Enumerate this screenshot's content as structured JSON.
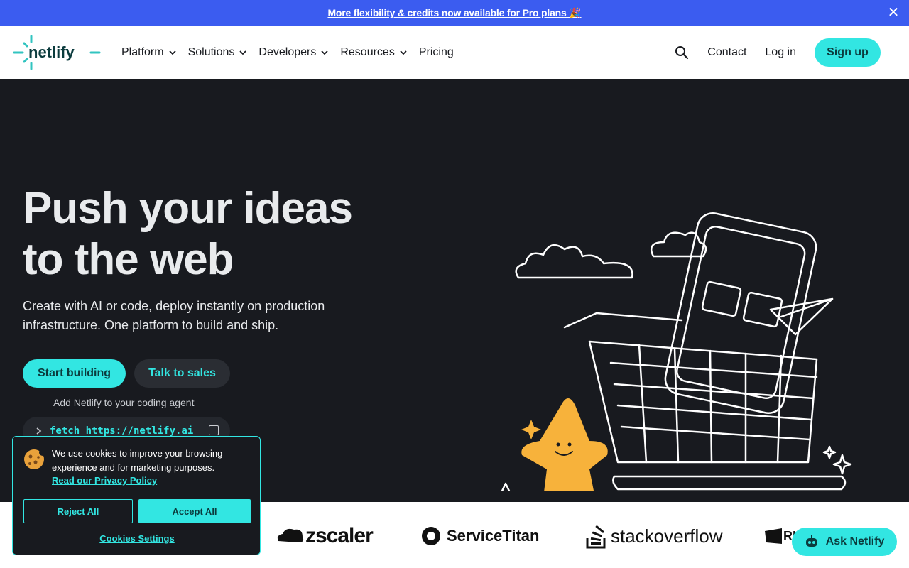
{
  "banner": {
    "text": "More flexibility & credits now available for Pro plans 🎉",
    "close": "✕"
  },
  "header": {
    "logo_text": "netlify",
    "nav": [
      {
        "label": "Platform"
      },
      {
        "label": "Solutions"
      },
      {
        "label": "Developers"
      },
      {
        "label": "Resources"
      },
      {
        "label": "Pricing"
      }
    ],
    "contact": "Contact",
    "login": "Log in",
    "signup": "Sign up",
    "search_icon": "search-icon"
  },
  "hero": {
    "title_line1": "Push your ideas",
    "title_line2": "to the web",
    "subtitle": "Create with AI or code, deploy instantly on production infrastructure. One platform to build and ship.",
    "primary_cta": "Start building",
    "secondary_cta": "Talk to sales",
    "agent_label": "Add Netlify to your coding agent",
    "agent_command": "fetch https://netlify.ai"
  },
  "logos": {
    "items": [
      "zscaler",
      "ServiceTitan",
      "stackoverflow",
      "RIOT"
    ]
  },
  "cookie": {
    "text": "We use cookies to improve your browsing experience and for marketing purposes.",
    "link": "Read our Privacy Policy",
    "reject": "Reject All",
    "accept": "Accept All",
    "settings": "Cookies Settings"
  },
  "ask": {
    "label": "Ask Netlify"
  },
  "colors": {
    "accent": "#32e6e2",
    "banner": "#3b5cf0",
    "dark": "#181a1f",
    "star": "#f7b23b"
  }
}
